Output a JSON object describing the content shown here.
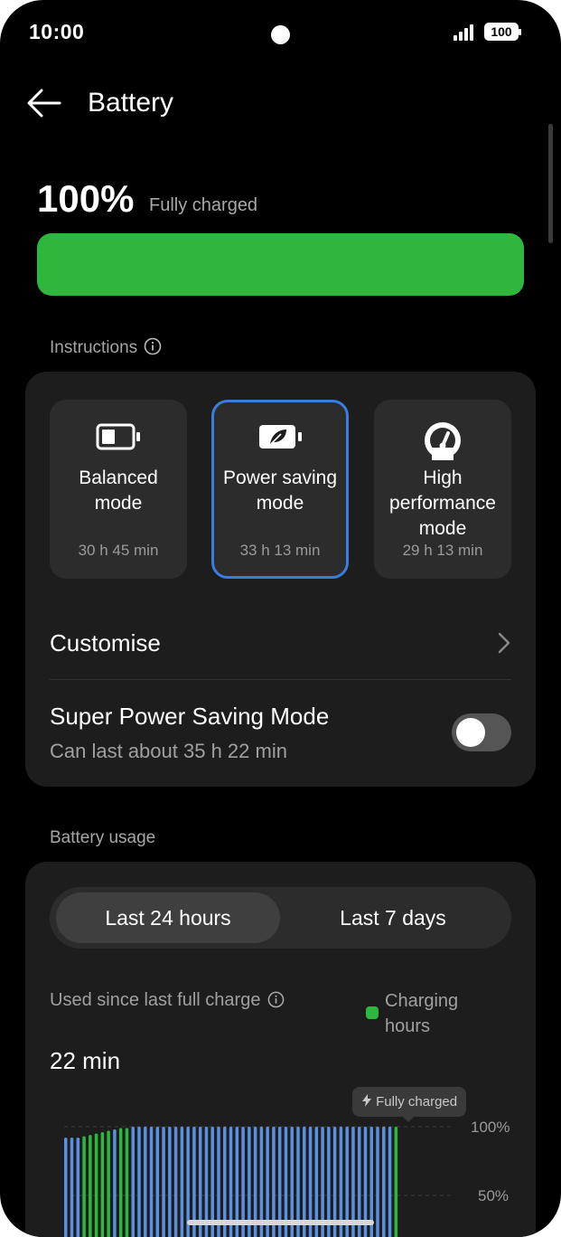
{
  "status_bar": {
    "time": "10:00",
    "battery_level": "100"
  },
  "header": {
    "title": "Battery"
  },
  "battery": {
    "percent": "100%",
    "state": "Fully charged",
    "level_fraction": 1.0,
    "bar_color": "#2db83d"
  },
  "instructions": {
    "label": "Instructions"
  },
  "modes": [
    {
      "name_line1": "Balanced",
      "name_line2": "mode",
      "time": "30 h 45 min",
      "icon": "battery-icon",
      "selected": false
    },
    {
      "name_line1": "Power saving",
      "name_line2": "mode",
      "time": "33 h 13 min",
      "icon": "leaf-battery-icon",
      "selected": true
    },
    {
      "name_line1": "High",
      "name_line2": "performance",
      "name_line3": "mode",
      "time": "29 h 13 min",
      "icon": "speedometer-icon",
      "selected": false
    }
  ],
  "customise": {
    "label": "Customise"
  },
  "super_saving": {
    "title": "Super Power Saving Mode",
    "subtitle": "Can last about 35 h 22 min",
    "enabled": false
  },
  "usage": {
    "label": "Battery usage",
    "tabs": [
      "Last 24 hours",
      "Last 7 days"
    ],
    "active_tab": 0,
    "used_label": "Used since last full charge",
    "used_value": "22 min",
    "legend_line1": "Charging",
    "legend_line2": "hours",
    "tooltip": "Fully charged",
    "y_labels": [
      "100%",
      "50%"
    ]
  },
  "colors": {
    "accent": "#3a7de0",
    "charging": "#2db83d",
    "discharging": "#5b8fdf"
  },
  "chart_data": {
    "type": "bar",
    "ylim": [
      0,
      100
    ],
    "y_ticks": [
      "100%",
      "50%"
    ],
    "series": [
      {
        "name": "Charging hours",
        "color": "#2db83d"
      },
      {
        "color": "#5b8fdf"
      }
    ],
    "bars": [
      {
        "v": 92,
        "s": 1
      },
      {
        "v": 92,
        "s": 1
      },
      {
        "v": 92,
        "s": 1
      },
      {
        "v": 93,
        "s": 0
      },
      {
        "v": 94,
        "s": 0
      },
      {
        "v": 95,
        "s": 0
      },
      {
        "v": 96,
        "s": 0
      },
      {
        "v": 97,
        "s": 0
      },
      {
        "v": 98,
        "s": 1
      },
      {
        "v": 99,
        "s": 0
      },
      {
        "v": 99,
        "s": 0
      },
      {
        "v": 100,
        "s": 1
      },
      {
        "v": 100,
        "s": 1
      },
      {
        "v": 100,
        "s": 1
      },
      {
        "v": 100,
        "s": 1
      },
      {
        "v": 100,
        "s": 1
      },
      {
        "v": 100,
        "s": 1
      },
      {
        "v": 100,
        "s": 1
      },
      {
        "v": 100,
        "s": 1
      },
      {
        "v": 100,
        "s": 1
      },
      {
        "v": 100,
        "s": 1
      },
      {
        "v": 100,
        "s": 1
      },
      {
        "v": 100,
        "s": 1
      },
      {
        "v": 100,
        "s": 1
      },
      {
        "v": 100,
        "s": 1
      },
      {
        "v": 100,
        "s": 1
      },
      {
        "v": 100,
        "s": 1
      },
      {
        "v": 100,
        "s": 1
      },
      {
        "v": 100,
        "s": 1
      },
      {
        "v": 100,
        "s": 1
      },
      {
        "v": 100,
        "s": 1
      },
      {
        "v": 100,
        "s": 1
      },
      {
        "v": 100,
        "s": 1
      },
      {
        "v": 100,
        "s": 1
      },
      {
        "v": 100,
        "s": 1
      },
      {
        "v": 100,
        "s": 1
      },
      {
        "v": 100,
        "s": 1
      },
      {
        "v": 100,
        "s": 1
      },
      {
        "v": 100,
        "s": 1
      },
      {
        "v": 100,
        "s": 1
      },
      {
        "v": 100,
        "s": 1
      },
      {
        "v": 100,
        "s": 1
      },
      {
        "v": 100,
        "s": 1
      },
      {
        "v": 100,
        "s": 1
      },
      {
        "v": 100,
        "s": 1
      },
      {
        "v": 100,
        "s": 1
      },
      {
        "v": 100,
        "s": 1
      },
      {
        "v": 100,
        "s": 1
      },
      {
        "v": 100,
        "s": 1
      },
      {
        "v": 100,
        "s": 1
      },
      {
        "v": 100,
        "s": 1
      },
      {
        "v": 100,
        "s": 1
      },
      {
        "v": 100,
        "s": 1
      },
      {
        "v": 100,
        "s": 1
      },
      {
        "v": 100,
        "s": 0
      }
    ]
  }
}
